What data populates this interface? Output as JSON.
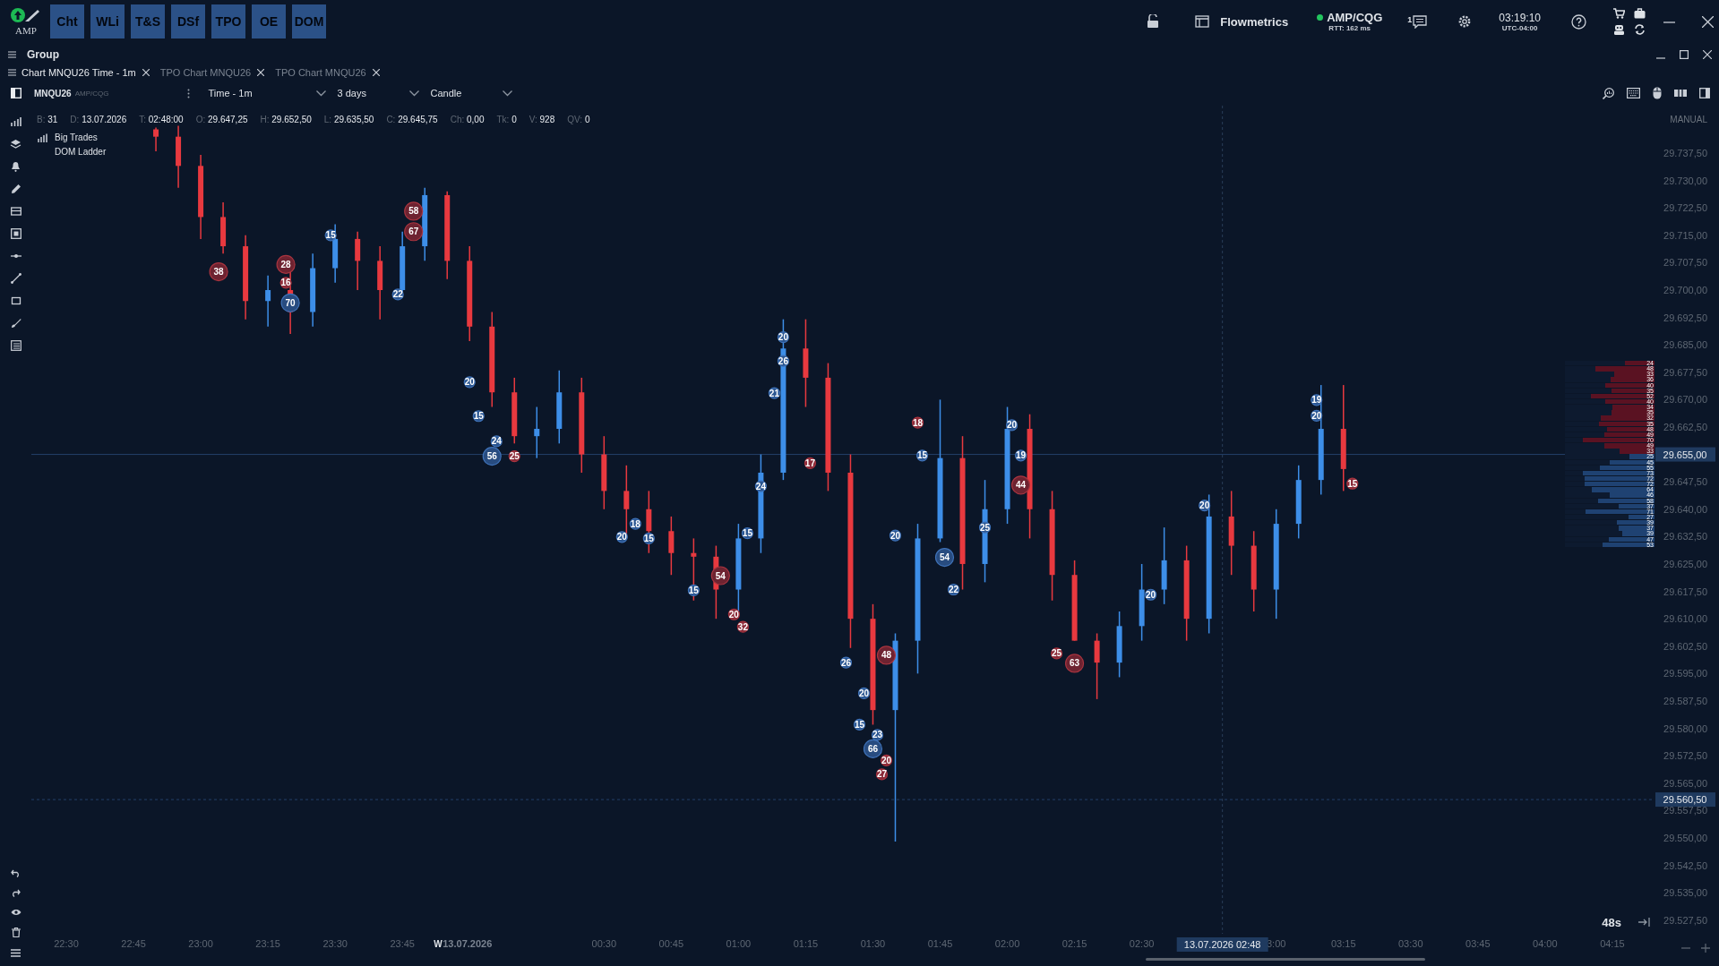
{
  "app": {
    "modules": [
      {
        "label": "Cht"
      },
      {
        "label": "WLi"
      },
      {
        "label": "T&S"
      },
      {
        "label": "DSf"
      },
      {
        "label": "TPO"
      },
      {
        "label": "OE"
      },
      {
        "label": "DOM"
      }
    ],
    "logo": "AMP",
    "workspace": "Flowmetrics",
    "connection": {
      "name": "AMP/CQG",
      "rtt": "RTT: 162 ms",
      "connected": true
    },
    "messages_count": "1",
    "clock": {
      "time": "03:19:10",
      "zone": "UTC-04:00"
    }
  },
  "group": {
    "title": "Group"
  },
  "tabs": [
    {
      "label": "Chart MNQU26 Time - 1m",
      "selected": true
    },
    {
      "label": "TPO Chart MNQU26",
      "selected": false
    },
    {
      "label": "TPO Chart MNQU26",
      "selected": false
    }
  ],
  "toolbar": {
    "symbol": "MNQU26",
    "feed": "AMP/CQG",
    "dropdowns": [
      {
        "value": "Time - 1m"
      },
      {
        "value": "3 days"
      },
      {
        "value": "Candle"
      }
    ]
  },
  "bar_info": [
    {
      "key": "B:",
      "value": "31"
    },
    {
      "key": "D:",
      "value": "13.07.2026"
    },
    {
      "key": "T:",
      "value": "02:48:00"
    },
    {
      "key": "O:",
      "value": "29.647,25"
    },
    {
      "key": "H:",
      "value": "29.652,50"
    },
    {
      "key": "L:",
      "value": "29.635,50"
    },
    {
      "key": "C:",
      "value": "29.645,75"
    },
    {
      "key": "Ch:",
      "value": "0,00"
    },
    {
      "key": "Tk:",
      "value": "0"
    },
    {
      "key": "V:",
      "value": "928"
    },
    {
      "key": "QV:",
      "value": "0"
    }
  ],
  "indicators": [
    {
      "label": "Big Trades",
      "kind": "icon"
    },
    {
      "label": "DOM Ladder",
      "kind": "plain"
    }
  ],
  "scale_mode": "MANUAL",
  "week_marker": "W",
  "crosshair": {
    "label": "13.07.2026 02:48"
  },
  "chart_data": {
    "type": "candlestick",
    "categories": [
      "22:30",
      null,
      null,
      "22:45",
      null,
      null,
      "23:00",
      null,
      null,
      "23:15",
      null,
      null,
      "23:30",
      null,
      null,
      "23:45",
      null,
      null,
      "13.07.2026",
      null,
      null,
      null,
      null,
      null,
      "00:30",
      null,
      null,
      "00:45",
      null,
      null,
      "01:00",
      null,
      null,
      "01:15",
      null,
      null,
      "01:30",
      null,
      null,
      "01:45",
      null,
      null,
      "02:00",
      null,
      null,
      "02:15",
      null,
      null,
      "02:30",
      null,
      null,
      null,
      null,
      null,
      "3:00",
      null,
      null,
      "03:15",
      null,
      null,
      "03:30",
      null,
      null,
      "03:45",
      null,
      null,
      "04:00",
      null,
      null,
      "04:15",
      null
    ],
    "ohlc": [
      null,
      null,
      null,
      null,
      [
        29744,
        29744.5,
        29738,
        29742
      ],
      [
        29742,
        29745,
        29728,
        29734
      ],
      [
        29734,
        29737,
        29714,
        29720
      ],
      [
        29720,
        29724,
        29710,
        29712
      ],
      [
        29712,
        29715,
        29692,
        29697
      ],
      [
        29697,
        29704,
        29690,
        29700
      ],
      [
        29700,
        29705,
        29688,
        29694
      ],
      [
        29694,
        29710,
        29690,
        29706
      ],
      [
        29706,
        29718,
        29702,
        29714
      ],
      [
        29714,
        29716,
        29700,
        29708
      ],
      [
        29708,
        29712,
        29692,
        29700
      ],
      [
        29700,
        29716,
        29698,
        29712
      ],
      [
        29712,
        29728,
        29708,
        29726
      ],
      [
        29726,
        29727,
        29703,
        29708
      ],
      [
        29708,
        29712,
        29686,
        29690
      ],
      [
        29690,
        29694,
        29668,
        29672
      ],
      [
        29672,
        29676,
        29658,
        29660
      ],
      [
        29660,
        29668,
        29654,
        29662
      ],
      [
        29662,
        29678,
        29658,
        29672
      ],
      [
        29672,
        29676,
        29650,
        29655
      ],
      [
        29655,
        29660,
        29640,
        29645
      ],
      [
        29645,
        29652,
        29633,
        29640
      ],
      [
        29640,
        29645,
        29628,
        29634
      ],
      [
        29634,
        29638,
        29622,
        29628
      ],
      [
        29628,
        29632,
        29615,
        29627
      ],
      [
        29627,
        29630,
        29610,
        29618
      ],
      [
        29618,
        29636,
        29612,
        29632
      ],
      [
        29632,
        29655,
        29628,
        29650
      ],
      [
        29650,
        29692,
        29648,
        29684
      ],
      [
        29684,
        29692,
        29668,
        29676
      ],
      [
        29676,
        29680,
        29645,
        29650
      ],
      [
        29650,
        29655,
        29602,
        29610
      ],
      [
        29610,
        29614,
        29581,
        29585
      ],
      [
        29585,
        29606,
        29549,
        29604
      ],
      [
        29604,
        29636,
        29595,
        29632
      ],
      [
        29632,
        29670,
        29631,
        29654
      ],
      [
        29654,
        29660,
        29618,
        29625
      ],
      [
        29625,
        29648,
        29620,
        29640
      ],
      [
        29640,
        29668,
        29636,
        29662
      ],
      [
        29662,
        29666,
        29632,
        29640
      ],
      [
        29640,
        29645,
        29615,
        29622
      ],
      [
        29622,
        29626,
        29604,
        29604
      ],
      [
        29604,
        29606,
        29588,
        29598
      ],
      [
        29598,
        29612,
        29594,
        29608
      ],
      [
        29608,
        29625,
        29604,
        29618
      ],
      [
        29618,
        29635,
        29614,
        29626
      ],
      [
        29626,
        29630,
        29604,
        29610
      ],
      [
        29610,
        29644,
        29606,
        29638
      ],
      [
        29638,
        29645,
        29622,
        29630
      ],
      [
        29630,
        29634,
        29612,
        29618
      ],
      [
        29618,
        29640,
        29610,
        29636
      ],
      [
        29636,
        29652,
        29632,
        29648
      ],
      [
        29648,
        29674,
        29644,
        29662
      ],
      [
        29662,
        29674,
        29645,
        29651
      ],
      null,
      null,
      null,
      null,
      null,
      null,
      null,
      null,
      null,
      null,
      null,
      null,
      null
    ],
    "ylim": [
      29523.75,
      29750.5
    ],
    "yticks": [
      {
        "value": 29737.5,
        "label": "29.737,50"
      },
      {
        "value": 29730,
        "label": "29.730,00"
      },
      {
        "value": 29722.5,
        "label": "29.722,50"
      },
      {
        "value": 29715,
        "label": "29.715,00"
      },
      {
        "value": 29707.5,
        "label": "29.707,50"
      },
      {
        "value": 29700,
        "label": "29.700,00"
      },
      {
        "value": 29692.5,
        "label": "29.692,50"
      },
      {
        "value": 29685,
        "label": "29.685,00"
      },
      {
        "value": 29677.5,
        "label": "29.677,50"
      },
      {
        "value": 29670,
        "label": "29.670,00"
      },
      {
        "value": 29662.5,
        "label": "29.662,50"
      },
      {
        "value": 29647.5,
        "label": "29.647,50"
      },
      {
        "value": 29640,
        "label": "29.640,00"
      },
      {
        "value": 29632.5,
        "label": "29.632,50"
      },
      {
        "value": 29625,
        "label": "29.625,00"
      },
      {
        "value": 29617.5,
        "label": "29.617,50"
      },
      {
        "value": 29610,
        "label": "29.610,00"
      },
      {
        "value": 29602.5,
        "label": "29.602,50"
      },
      {
        "value": 29595,
        "label": "29.595,00"
      },
      {
        "value": 29587.5,
        "label": "29.587,50"
      },
      {
        "value": 29580,
        "label": "29.580,00"
      },
      {
        "value": 29572.5,
        "label": "29.572,50"
      },
      {
        "value": 29565,
        "label": "29.565,00"
      },
      {
        "value": 29557.5,
        "label": "29.557,50"
      },
      {
        "value": 29550,
        "label": "29.550,00"
      },
      {
        "value": 29542.5,
        "label": "29.542,50"
      },
      {
        "value": 29535,
        "label": "29.535,00"
      },
      {
        "value": 29527.5,
        "label": "29.527,50"
      }
    ],
    "ref_lines": [
      {
        "axis": "y",
        "value": 29655,
        "label": "29.655,00"
      },
      {
        "axis": "y",
        "value": 29560.5,
        "label": "29.560,50"
      }
    ]
  },
  "big_trades": [
    {
      "text": "38",
      "color": "#6e2331"
    },
    {
      "text": "28",
      "color": "#6e2331"
    },
    {
      "text": "16",
      "color": "#8a2a38"
    },
    {
      "text": "70",
      "color": "#284c80"
    },
    {
      "text": "15",
      "color": "#2a5590"
    },
    {
      "text": "58",
      "color": "#6e2331"
    },
    {
      "text": "67",
      "color": "#6e2331"
    },
    {
      "text": "22",
      "color": "#2a5590"
    },
    {
      "text": "20",
      "color": "#2a5590"
    },
    {
      "text": "15",
      "color": "#2a5590"
    },
    {
      "text": "24",
      "color": "#2a5590"
    },
    {
      "text": "56",
      "color": "#284c80"
    },
    {
      "text": "25",
      "color": "#8a2a38"
    },
    {
      "text": "18",
      "color": "#2a5590"
    },
    {
      "text": "20",
      "color": "#2a5590"
    },
    {
      "text": "15",
      "color": "#2a5590"
    },
    {
      "text": "15",
      "color": "#2a5590"
    },
    {
      "text": "54",
      "color": "#6e2331"
    },
    {
      "text": "20",
      "color": "#8a2a38"
    },
    {
      "text": "32",
      "color": "#8a2a38"
    },
    {
      "text": "15",
      "color": "#2a5590"
    },
    {
      "text": "24",
      "color": "#2a5590"
    },
    {
      "text": "21",
      "color": "#2a5590"
    },
    {
      "text": "26",
      "color": "#2a5590"
    },
    {
      "text": "20",
      "color": "#2a5590"
    },
    {
      "text": "17",
      "color": "#8a2a38"
    },
    {
      "text": "26",
      "color": "#2a5590"
    },
    {
      "text": "20",
      "color": "#2a5590"
    },
    {
      "text": "15",
      "color": "#2a5590"
    },
    {
      "text": "66",
      "color": "#284c80"
    },
    {
      "text": "23",
      "color": "#2a5590"
    },
    {
      "text": "20",
      "color": "#8a2a38"
    },
    {
      "text": "27",
      "color": "#8a2a38"
    },
    {
      "text": "48",
      "color": "#6e2331"
    },
    {
      "text": "20",
      "color": "#2a5590"
    },
    {
      "text": "18",
      "color": "#8a2a38"
    },
    {
      "text": "15",
      "color": "#2a5590"
    },
    {
      "text": "54",
      "color": "#284c80"
    },
    {
      "text": "22",
      "color": "#2a5590"
    },
    {
      "text": "25",
      "color": "#2a5590"
    },
    {
      "text": "20",
      "color": "#2a5590"
    },
    {
      "text": "19",
      "color": "#2a5590"
    },
    {
      "text": "44",
      "color": "#6e2331"
    },
    {
      "text": "25",
      "color": "#8a2a38"
    },
    {
      "text": "63",
      "color": "#6e2331"
    },
    {
      "text": "20",
      "color": "#2a5590"
    },
    {
      "text": "20",
      "color": "#2a5590"
    },
    {
      "text": "19",
      "color": "#2a5590"
    },
    {
      "text": "20",
      "color": "#2a5590"
    },
    {
      "text": "15",
      "color": "#8a2a38"
    }
  ],
  "volume_profile": [
    {
      "value": "24",
      "color": "#5a1222",
      "level": 0.33
    },
    {
      "value": "48",
      "color": "#5a1222",
      "level": 0.66
    },
    {
      "value": "33",
      "color": "#5a1222",
      "level": 0.45
    },
    {
      "value": "36",
      "color": "#5a1222",
      "level": 0.49
    },
    {
      "value": "40",
      "color": "#5a1222",
      "level": 0.55
    },
    {
      "value": "35",
      "color": "#5a1222",
      "level": 0.48
    },
    {
      "value": "52",
      "color": "#5a1222",
      "level": 0.71
    },
    {
      "value": "40",
      "color": "#5a1222",
      "level": 0.55
    },
    {
      "value": "34",
      "color": "#5a1222",
      "level": 0.47
    },
    {
      "value": "35",
      "color": "#5a1222",
      "level": 0.48
    },
    {
      "value": "32",
      "color": "#5a1222",
      "level": 0.6
    },
    {
      "value": "35",
      "color": "#5a1222",
      "level": 0.62
    },
    {
      "value": "48",
      "color": "#5a1222",
      "level": 0.53
    },
    {
      "value": "49",
      "color": "#5a1222",
      "level": 0.56
    },
    {
      "value": "70",
      "color": "#5a1222",
      "level": 0.8
    },
    {
      "value": "49",
      "color": "#5a1222",
      "level": 0.56
    },
    {
      "value": "33",
      "color": "#5a1222",
      "level": 0.39
    },
    {
      "value": "25",
      "color": "#1f4272",
      "level": 0.28
    },
    {
      "value": "45",
      "color": "#1f4272",
      "level": 0.5
    },
    {
      "value": "55",
      "color": "#1f4272",
      "level": 0.61
    },
    {
      "value": "73",
      "color": "#1f4272",
      "level": 0.8
    },
    {
      "value": "72",
      "color": "#1f4272",
      "level": 0.78
    },
    {
      "value": "72",
      "color": "#1f4272",
      "level": 0.78
    },
    {
      "value": "64",
      "color": "#1f4272",
      "level": 0.7
    },
    {
      "value": "46",
      "color": "#1f4272",
      "level": 0.5
    },
    {
      "value": "58",
      "color": "#1f4272",
      "level": 0.63
    },
    {
      "value": "37",
      "color": "#1f4272",
      "level": 0.4
    },
    {
      "value": "71",
      "color": "#1f4272",
      "level": 0.77
    },
    {
      "value": "27",
      "color": "#1f4272",
      "level": 0.29
    },
    {
      "value": "39",
      "color": "#1f4272",
      "level": 0.42
    },
    {
      "value": "37",
      "color": "#1f4272",
      "level": 0.4
    },
    {
      "value": "39",
      "color": "#1f4272",
      "level": 0.36
    },
    {
      "value": "47",
      "color": "#1f4272",
      "level": 0.51
    },
    {
      "value": "53",
      "color": "#1f4272",
      "level": 0.58
    }
  ],
  "countdown": "48s"
}
